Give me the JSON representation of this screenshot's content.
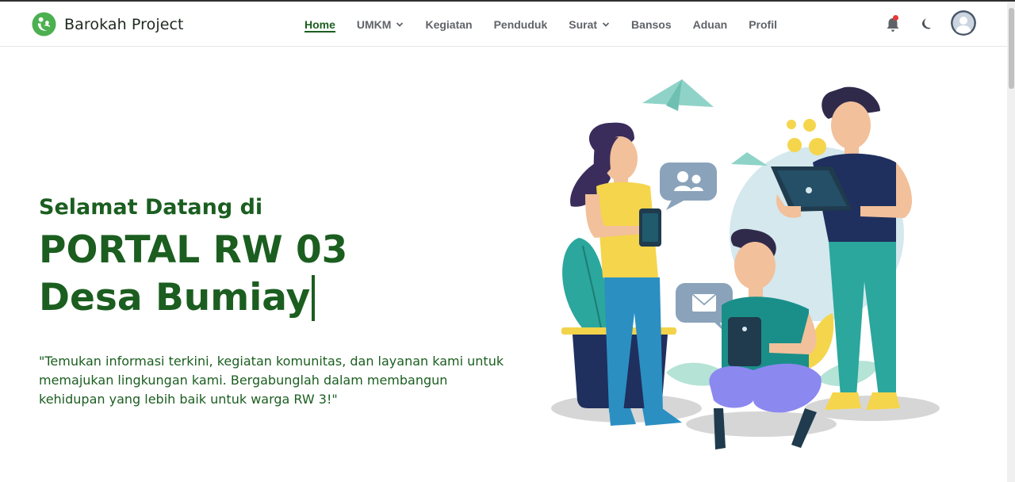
{
  "brand": {
    "name": "Barokah Project",
    "logo_icon": "family-leaf-logo",
    "color": "#4caf50"
  },
  "nav": {
    "items": [
      {
        "label": "Home",
        "active": true,
        "dropdown": false
      },
      {
        "label": "UMKM",
        "active": false,
        "dropdown": true
      },
      {
        "label": "Kegiatan",
        "active": false,
        "dropdown": false
      },
      {
        "label": "Penduduk",
        "active": false,
        "dropdown": false
      },
      {
        "label": "Surat",
        "active": false,
        "dropdown": true
      },
      {
        "label": "Bansos",
        "active": false,
        "dropdown": false
      },
      {
        "label": "Aduan",
        "active": false,
        "dropdown": false
      },
      {
        "label": "Profil",
        "active": false,
        "dropdown": false
      }
    ],
    "icons": {
      "notification": "bell-icon",
      "theme_toggle": "moon-icon",
      "user": "avatar"
    }
  },
  "hero": {
    "welcome": "Selamat Datang di",
    "title_line1": "PORTAL RW 03",
    "title_line2": "Desa Bumiay",
    "description": "\"Temukan informasi terkini, kegiatan komunitas, dan layanan kami untuk memajukan lingkungan kami. Bergabunglah dalam membangun kehidupan yang lebih baik untuk warga RW 3!\""
  },
  "colors": {
    "primary": "#1b5e20",
    "nav_text": "#5f6368",
    "notification_dot": "#e53935"
  }
}
